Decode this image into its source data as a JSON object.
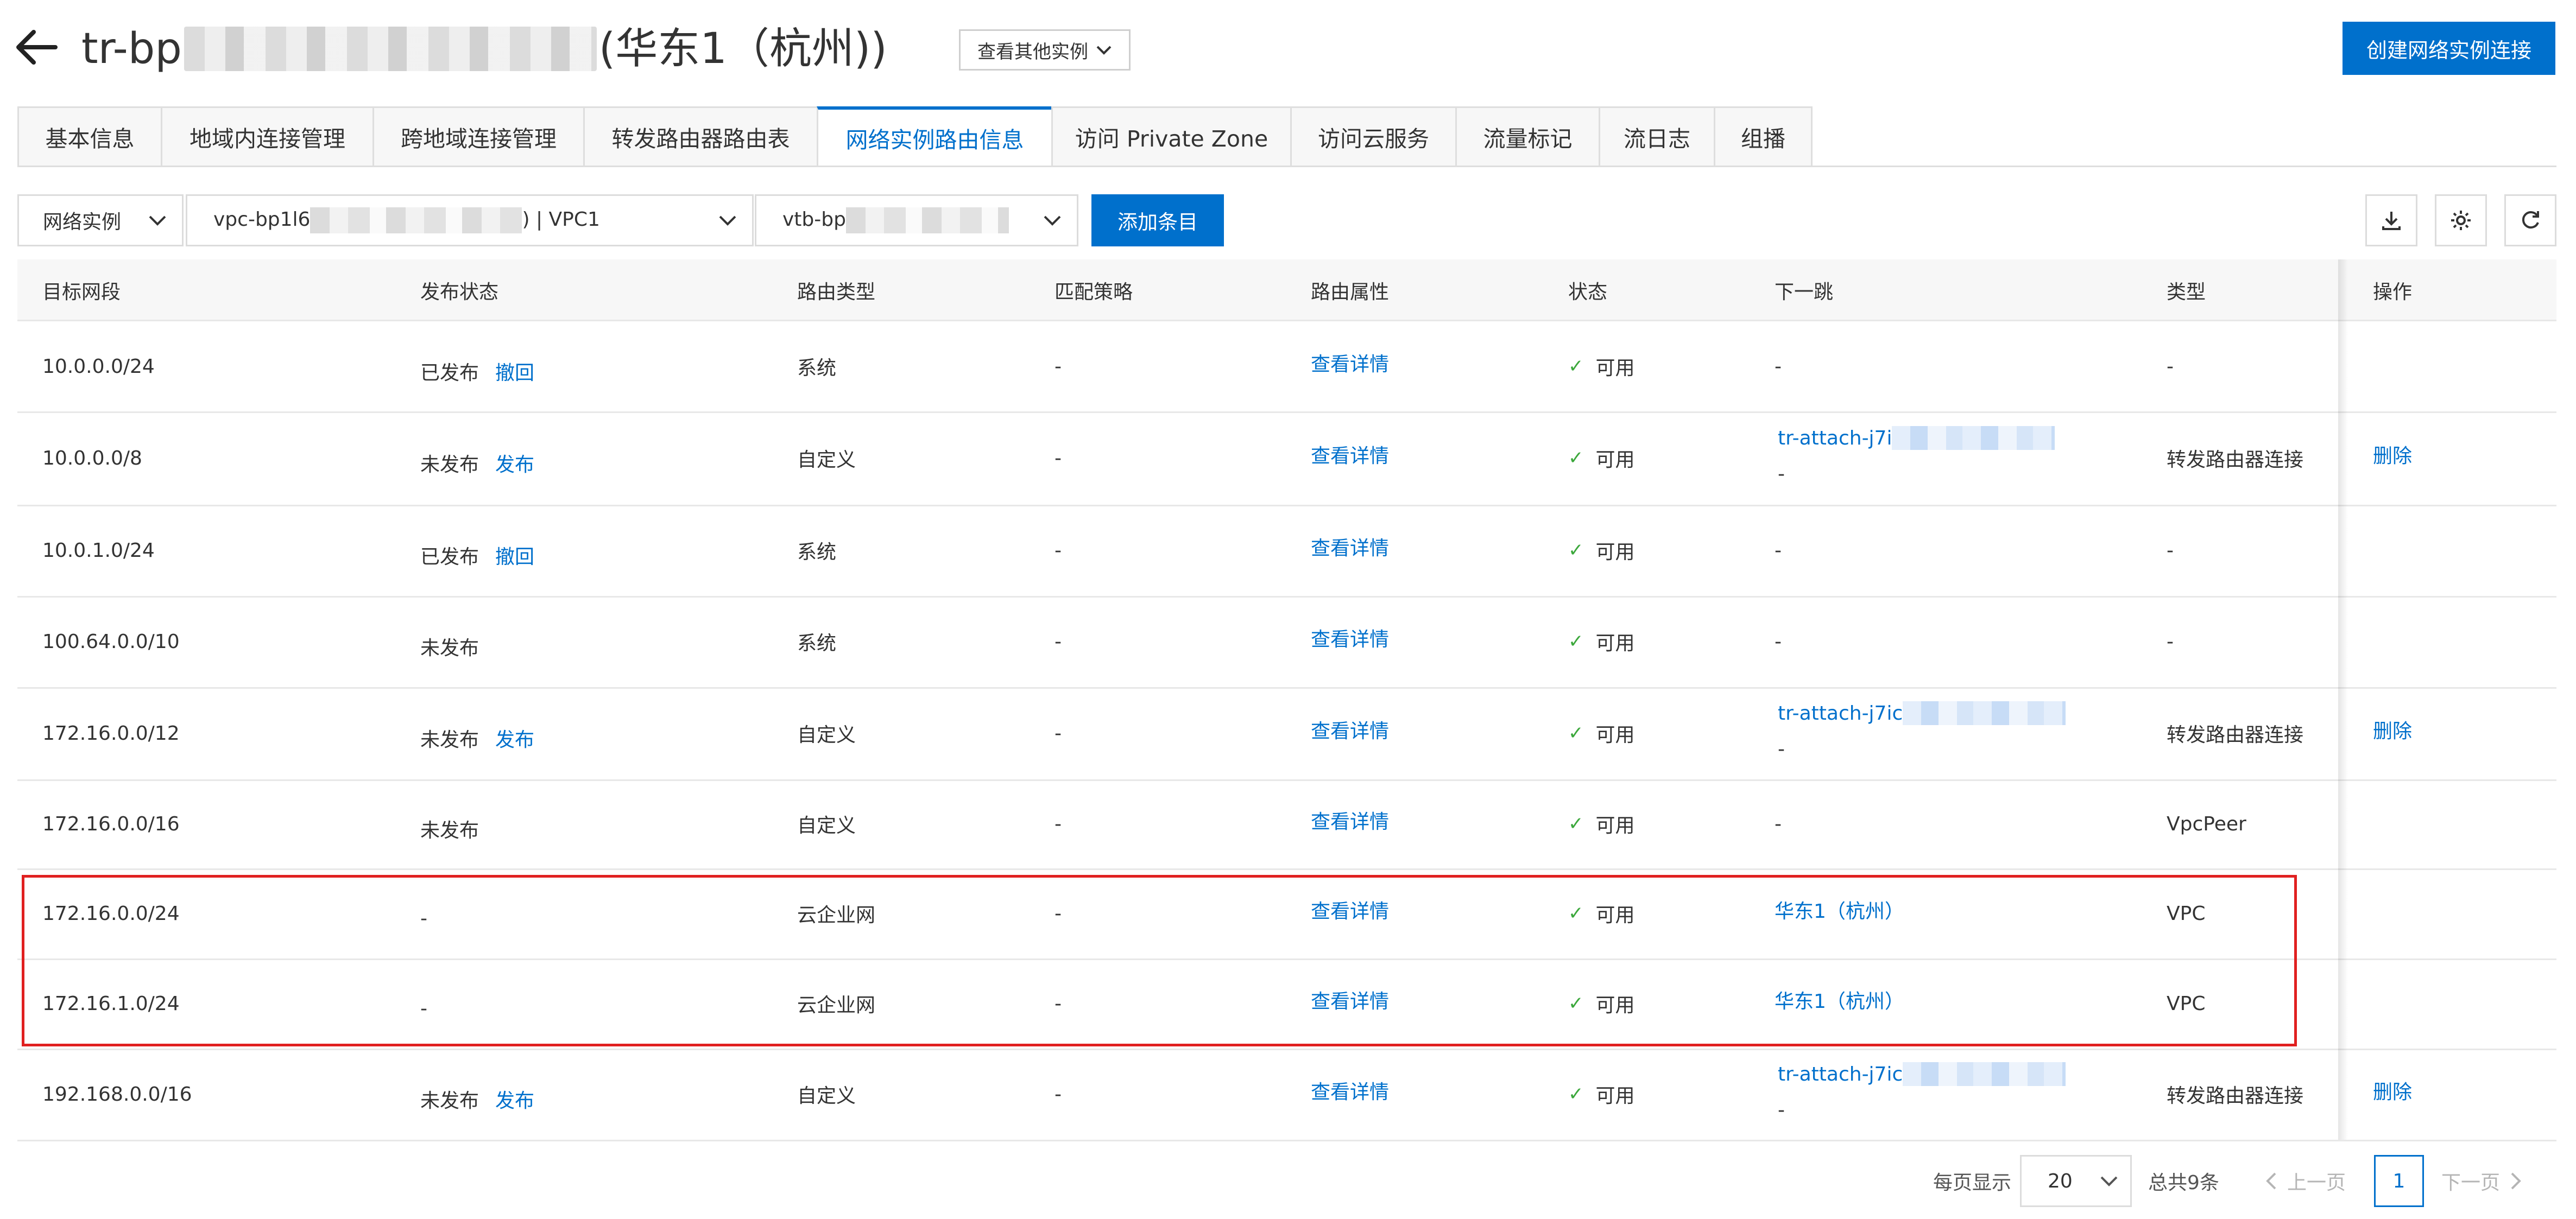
{
  "header": {
    "title_prefix": "tr-bp",
    "title_suffix": "(华东1（杭州))",
    "switch_label": "查看其他实例",
    "create_label": "创建网络实例连接"
  },
  "tabs": [
    {
      "label": "基本信息",
      "active": false
    },
    {
      "label": "地域内连接管理",
      "active": false
    },
    {
      "label": "跨地域连接管理",
      "active": false
    },
    {
      "label": "转发路由器路由表",
      "active": false
    },
    {
      "label": "网络实例路由信息",
      "active": true
    },
    {
      "label": "访问 Private Zone",
      "active": false
    },
    {
      "label": "访问云服务",
      "active": false
    },
    {
      "label": "流量标记",
      "active": false
    },
    {
      "label": "流日志",
      "active": false
    },
    {
      "label": "组播",
      "active": false
    }
  ],
  "filters": {
    "type_select": "网络实例",
    "vpc_prefix": "vpc-bp1l6",
    "vpc_suffix": ") | VPC1",
    "vtb_prefix": "vtb-bp",
    "add_label": "添加条目"
  },
  "table": {
    "headers": [
      "目标网段",
      "发布状态",
      "路由类型",
      "匹配策略",
      "路由属性",
      "状态",
      "下一跳",
      "类型",
      "操作"
    ],
    "rows": [
      {
        "cidr": "10.0.0.0/24",
        "publish": "已发布",
        "publish_action": "撤回",
        "route_type": "系统",
        "policy": "-",
        "attr": "查看详情",
        "status": "可用",
        "next_hop": "-",
        "next_hop_sub": "",
        "kind": "-",
        "op": ""
      },
      {
        "cidr": "10.0.0.0/8",
        "publish": "未发布",
        "publish_action": "发布",
        "route_type": "自定义",
        "policy": "-",
        "attr": "查看详情",
        "status": "可用",
        "next_hop": "tr-attach-j7i",
        "next_hop_sub": "-",
        "kind": "转发路由器连接",
        "op": "删除"
      },
      {
        "cidr": "10.0.1.0/24",
        "publish": "已发布",
        "publish_action": "撤回",
        "route_type": "系统",
        "policy": "-",
        "attr": "查看详情",
        "status": "可用",
        "next_hop": "-",
        "next_hop_sub": "",
        "kind": "-",
        "op": ""
      },
      {
        "cidr": "100.64.0.0/10",
        "publish": "未发布",
        "publish_action": "",
        "route_type": "系统",
        "policy": "-",
        "attr": "查看详情",
        "status": "可用",
        "next_hop": "-",
        "next_hop_sub": "",
        "kind": "-",
        "op": ""
      },
      {
        "cidr": "172.16.0.0/12",
        "publish": "未发布",
        "publish_action": "发布",
        "route_type": "自定义",
        "policy": "-",
        "attr": "查看详情",
        "status": "可用",
        "next_hop": "tr-attach-j7ic",
        "next_hop_sub": "-",
        "kind": "转发路由器连接",
        "op": "删除"
      },
      {
        "cidr": "172.16.0.0/16",
        "publish": "未发布",
        "publish_action": "",
        "route_type": "自定义",
        "policy": "-",
        "attr": "查看详情",
        "status": "可用",
        "next_hop": "-",
        "next_hop_sub": "",
        "kind": "VpcPeer",
        "op": ""
      },
      {
        "cidr": "172.16.0.0/24",
        "publish": "-",
        "publish_action": "",
        "route_type": "云企业网",
        "policy": "-",
        "attr": "查看详情",
        "status": "可用",
        "next_hop": "华东1（杭州）",
        "next_hop_sub": "",
        "kind": "VPC",
        "op": ""
      },
      {
        "cidr": "172.16.1.0/24",
        "publish": "-",
        "publish_action": "",
        "route_type": "云企业网",
        "policy": "-",
        "attr": "查看详情",
        "status": "可用",
        "next_hop": "华东1（杭州）",
        "next_hop_sub": "",
        "kind": "VPC",
        "op": ""
      },
      {
        "cidr": "192.168.0.0/16",
        "publish": "未发布",
        "publish_action": "发布",
        "route_type": "自定义",
        "policy": "-",
        "attr": "查看详情",
        "status": "可用",
        "next_hop": "tr-attach-j7ic",
        "next_hop_sub": "-",
        "kind": "转发路由器连接",
        "op": "删除"
      }
    ]
  },
  "pagination": {
    "per_page_label": "每页显示",
    "per_page_value": "20",
    "total_label": "总共9条",
    "prev_label": "上一页",
    "current_page": "1",
    "next_label": "下一页"
  },
  "colors": {
    "accent": "#0070cc",
    "success": "#3ca83c",
    "highlight": "#e02020"
  }
}
